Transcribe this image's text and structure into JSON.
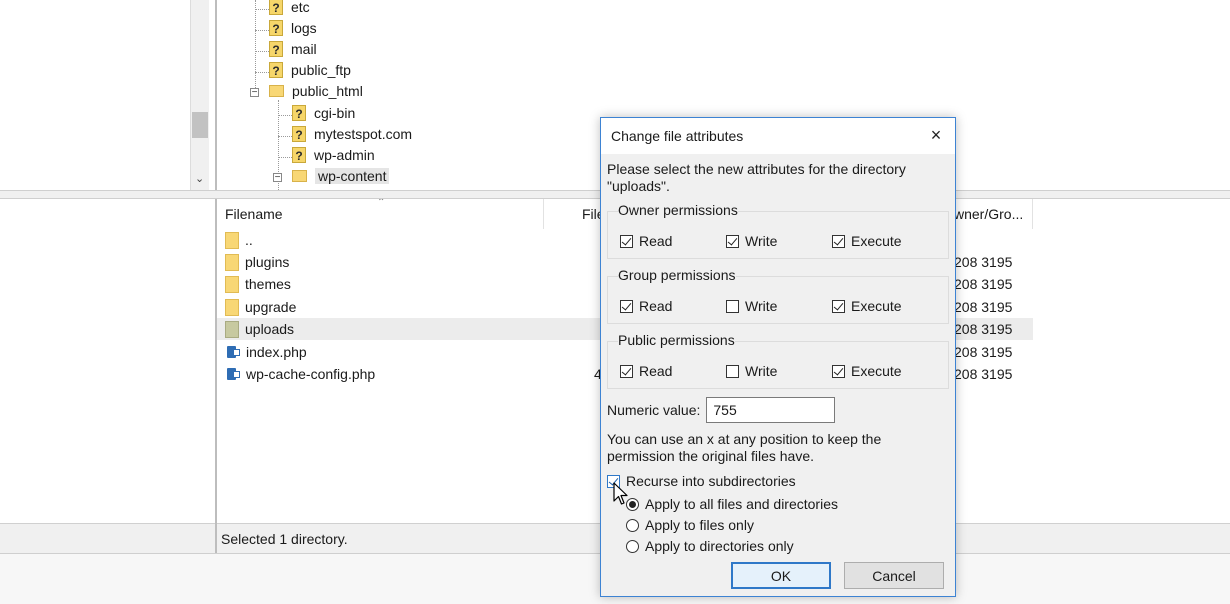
{
  "tree": {
    "items": [
      {
        "label": "etc",
        "icon": "unknown-folder-icon"
      },
      {
        "label": "logs",
        "icon": "unknown-folder-icon"
      },
      {
        "label": "mail",
        "icon": "unknown-folder-icon"
      },
      {
        "label": "public_ftp",
        "icon": "unknown-folder-icon"
      },
      {
        "label": "public_html",
        "icon": "folder-icon"
      },
      {
        "label": "cgi-bin",
        "icon": "unknown-folder-icon"
      },
      {
        "label": "mytestspot.com",
        "icon": "unknown-folder-icon"
      },
      {
        "label": "wp-admin",
        "icon": "unknown-folder-icon"
      },
      {
        "label": "wp-content",
        "icon": "folder-icon"
      }
    ],
    "expander_collapse": "−",
    "scroll_down": "⌄"
  },
  "filelist": {
    "headers": {
      "filename": "Filename",
      "filesize": "File",
      "owner": "wner/Gro..."
    },
    "sort_arrow": "⌃",
    "rows": [
      {
        "name": "..",
        "size": "",
        "owner": "",
        "type": "parent"
      },
      {
        "name": "plugins",
        "size": "",
        "owner": "208 3195",
        "type": "folder"
      },
      {
        "name": "themes",
        "size": "",
        "owner": "208 3195",
        "type": "folder"
      },
      {
        "name": "upgrade",
        "size": "",
        "owner": "208 3195",
        "type": "folder"
      },
      {
        "name": "uploads",
        "size": "",
        "owner": "208 3195",
        "type": "folder-selected"
      },
      {
        "name": "index.php",
        "size": "",
        "owner": "208 3195",
        "type": "php"
      },
      {
        "name": "wp-cache-config.php",
        "size": "4",
        "owner": "208 3195",
        "type": "php"
      }
    ],
    "status": "Selected 1 directory."
  },
  "dialog": {
    "title": "Change file attributes",
    "close": "×",
    "intro": "Please select the new attributes for the directory \"uploads\".",
    "groups": [
      {
        "title": "Owner permissions",
        "read": "Read",
        "write": "Write",
        "execute": "Execute",
        "read_on": true,
        "write_on": true,
        "execute_on": true
      },
      {
        "title": "Group permissions",
        "read": "Read",
        "write": "Write",
        "execute": "Execute",
        "read_on": true,
        "write_on": false,
        "execute_on": true
      },
      {
        "title": "Public permissions",
        "read": "Read",
        "write": "Write",
        "execute": "Execute",
        "read_on": true,
        "write_on": false,
        "execute_on": true
      }
    ],
    "numeric_label": "Numeric value:",
    "numeric_value": "755",
    "hint": "You can use an x at any position to keep the permission the original files have.",
    "recurse_label": "Recurse into subdirectories",
    "recurse_on": true,
    "radios": [
      {
        "label": "Apply to all files and directories",
        "selected": true
      },
      {
        "label": "Apply to files only",
        "selected": false
      },
      {
        "label": "Apply to directories only",
        "selected": false
      }
    ],
    "ok_label": "OK",
    "cancel_label": "Cancel"
  }
}
